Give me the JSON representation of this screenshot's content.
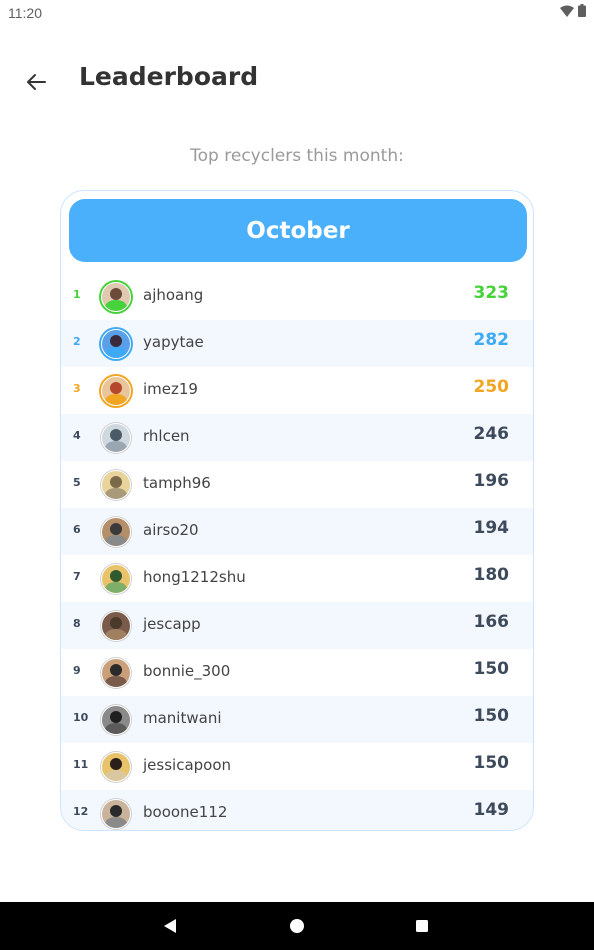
{
  "status_bar": {
    "time": "11:20",
    "wifi_icon": "wifi-icon",
    "battery_icon": "battery-icon"
  },
  "header": {
    "back_icon": "arrow-left-icon",
    "title": "Leaderboard"
  },
  "subtitle": "Top recyclers this month:",
  "card": {
    "month": "October",
    "colors": {
      "banner": "#4bb0fb",
      "border": "#cfe4fb",
      "alt_row": "#f3f7fe",
      "first": "#45d23a",
      "second": "#3ea9f5",
      "third": "#f2a521",
      "default": "#3d4a5c"
    },
    "rows": [
      {
        "rank": "1",
        "username": "ajhoang",
        "score": "323"
      },
      {
        "rank": "2",
        "username": "yapytae",
        "score": "282"
      },
      {
        "rank": "3",
        "username": "imez19",
        "score": "250"
      },
      {
        "rank": "4",
        "username": "rhlcen",
        "score": "246"
      },
      {
        "rank": "5",
        "username": "tamph96",
        "score": "196"
      },
      {
        "rank": "6",
        "username": "airso20",
        "score": "194"
      },
      {
        "rank": "7",
        "username": "hong1212shu",
        "score": "180"
      },
      {
        "rank": "8",
        "username": "jescapp",
        "score": "166"
      },
      {
        "rank": "9",
        "username": "bonnie_300",
        "score": "150"
      },
      {
        "rank": "10",
        "username": "manitwani",
        "score": "150"
      },
      {
        "rank": "11",
        "username": "jessicapoon",
        "score": "150"
      },
      {
        "rank": "12",
        "username": "booone112",
        "score": "149"
      }
    ]
  },
  "nav_bar": {
    "back_icon": "nav-back-icon",
    "home_icon": "nav-home-icon",
    "recents_icon": "nav-recents-icon"
  }
}
